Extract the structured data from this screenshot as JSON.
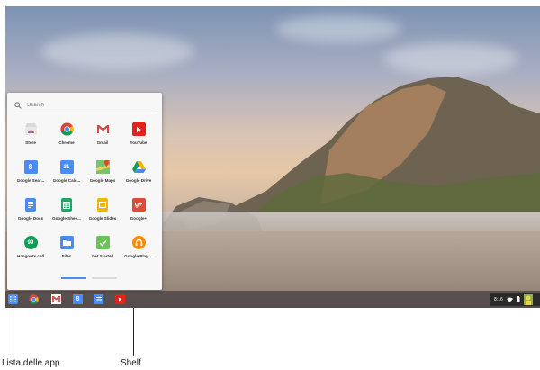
{
  "launcher": {
    "search_placeholder": "Search",
    "apps": [
      {
        "label": "Store",
        "icon": "store-icon",
        "color": "#ffffff"
      },
      {
        "label": "Chrome",
        "icon": "chrome-icon",
        "color": "#ffffff"
      },
      {
        "label": "Gmail",
        "icon": "gmail-icon",
        "color": "#ffffff"
      },
      {
        "label": "YouTube",
        "icon": "youtube-icon",
        "color": "#e62117"
      },
      {
        "label": "Google Sear...",
        "icon": "google-search-icon",
        "color": "#4a8cf5"
      },
      {
        "label": "Google Cale...",
        "icon": "google-calendar-icon",
        "color": "#4a8cf5"
      },
      {
        "label": "Google Maps",
        "icon": "google-maps-icon",
        "color": "#6fb55a"
      },
      {
        "label": "Google Drive",
        "icon": "google-drive-icon",
        "color": "#ffffff"
      },
      {
        "label": "Google Docs",
        "icon": "google-docs-icon",
        "color": "#4a8cf5"
      },
      {
        "label": "Google Shee...",
        "icon": "google-sheets-icon",
        "color": "#21a464"
      },
      {
        "label": "Google Slides",
        "icon": "google-slides-icon",
        "color": "#f4b400"
      },
      {
        "label": "Google+",
        "icon": "google-plus-icon",
        "color": "#dd4b39"
      },
      {
        "label": "Hangouts call",
        "icon": "hangouts-icon",
        "color": "#0f9d58"
      },
      {
        "label": "Files",
        "icon": "files-icon",
        "color": "#4a8cf5"
      },
      {
        "label": "Get Started",
        "icon": "get-started-icon",
        "color": "#6ac259"
      },
      {
        "label": "Google Play ...",
        "icon": "google-play-music-icon",
        "color": "#ff8a00"
      }
    ]
  },
  "shelf": {
    "time": "8:16",
    "items": [
      "app-launcher-icon",
      "chrome-icon",
      "gmail-icon",
      "google-search-icon",
      "google-docs-icon",
      "youtube-icon"
    ]
  },
  "callouts": {
    "launcher_label": "Lista delle app",
    "shelf_label": "Shelf"
  }
}
